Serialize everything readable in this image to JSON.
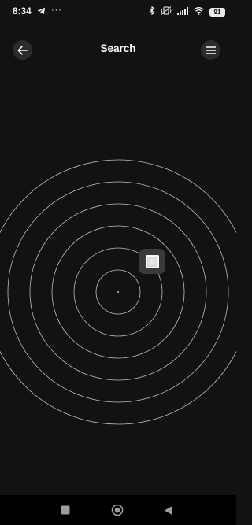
{
  "status_bar": {
    "time": "8:34",
    "overflow_indicator": "···",
    "battery": "91",
    "icons": [
      "telegram-icon",
      "bluetooth-icon",
      "vibrate-icon",
      "signal-icon",
      "wifi-icon",
      "battery-icon"
    ]
  },
  "header": {
    "title": "Search",
    "back_icon": "arrow-left-icon",
    "menu_icon": "hamburger-menu-icon"
  },
  "radar": {
    "ring_count": 6,
    "found_device_icon": "device-icon"
  },
  "nav_bar": {
    "icons": [
      "recents-square-icon",
      "home-circle-icon",
      "back-triangle-icon"
    ]
  },
  "colors": {
    "background": "#121212",
    "ring": "#bdbdbd",
    "nav_background": "#000000",
    "button_background": "#2c2c2c"
  }
}
